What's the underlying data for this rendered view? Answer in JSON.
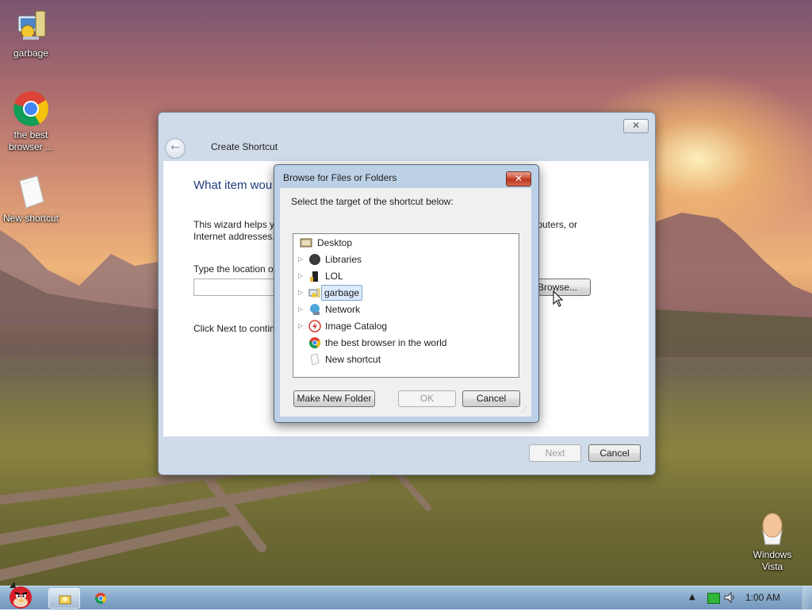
{
  "desktop": {
    "icons": [
      {
        "label": "garbage",
        "icon": "computer-drive-icon"
      },
      {
        "label": "the best browser ...",
        "icon": "chrome-icon"
      },
      {
        "label": "New shortcut",
        "icon": "blank-file-icon"
      },
      {
        "label": "Windows Vista",
        "icon": "vista-egg-icon"
      }
    ]
  },
  "wizard": {
    "title": "Create Shortcut",
    "close_label": "✕",
    "heading": "What item wou",
    "description": "This wizard helps y",
    "description_right": "s, computers, or",
    "description_line2": "Internet addresses.",
    "location_label": "Type the location o",
    "location_value": "",
    "browse_label": "Browse...",
    "click_next": "Click Next to contin",
    "next_label": "Next",
    "cancel_label": "Cancel"
  },
  "browse_dialog": {
    "title": "Browse for Files or Folders",
    "close_label": "✕",
    "prompt": "Select the target of the shortcut below:",
    "tree": [
      {
        "label": "Desktop",
        "icon": "desktop-icon",
        "expandable": false,
        "selected": false
      },
      {
        "label": "Libraries",
        "icon": "libraries-icon",
        "expandable": true,
        "selected": false
      },
      {
        "label": "LOL",
        "icon": "user-folder-icon",
        "expandable": true,
        "selected": false
      },
      {
        "label": "garbage",
        "icon": "computer-icon",
        "expandable": true,
        "selected": true
      },
      {
        "label": "Network",
        "icon": "network-icon",
        "expandable": true,
        "selected": false
      },
      {
        "label": "Image Catalog",
        "icon": "image-catalog-icon",
        "expandable": true,
        "selected": false
      },
      {
        "label": "the best browser in the world",
        "icon": "chrome-icon",
        "expandable": false,
        "selected": false
      },
      {
        "label": "New shortcut",
        "icon": "shortcut-file-icon",
        "expandable": false,
        "selected": false
      }
    ],
    "make_folder_label": "Make New Folder",
    "ok_label": "OK",
    "cancel_label": "Cancel"
  },
  "taskbar": {
    "start_icon": "angry-bird-start-icon",
    "pinned": [
      "explorer-icon",
      "chrome-icon"
    ],
    "tray_icons": [
      "show-hidden-icon",
      "battery-icon",
      "volume-icon"
    ],
    "clock": "1:00 AM"
  }
}
